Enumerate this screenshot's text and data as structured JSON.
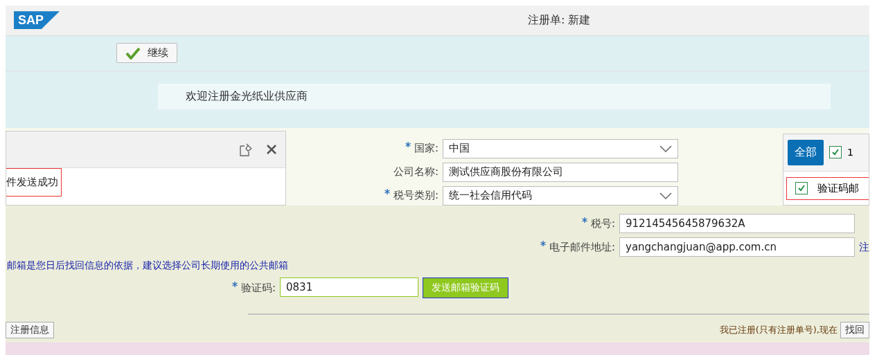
{
  "header": {
    "logo": "SAP",
    "title": "注册单: 新建"
  },
  "toolbar": {
    "continue_button": "继续"
  },
  "welcome": {
    "text": "欢迎注册金光纸业供应商"
  },
  "message_popup": {
    "message": "件发送成功"
  },
  "form_top": [
    {
      "label": "国家:",
      "required": true,
      "value": "中国",
      "kind": "select"
    },
    {
      "label": "公司名称:",
      "required": false,
      "value": "测试供应商股份有限公司",
      "kind": "input"
    },
    {
      "label": "税号类别:",
      "required": true,
      "value": "统一社会信用代码",
      "kind": "select"
    }
  ],
  "filter_panel": {
    "all_button": "全部",
    "checked": true,
    "count": "1",
    "items": [
      {
        "label": "验证码邮",
        "checked": true
      }
    ]
  },
  "form_bottom": [
    {
      "label": "税号:",
      "required": true,
      "value": "91214545645879632A"
    },
    {
      "label": "电子邮件地址:",
      "required": true,
      "value": "yangchangjuan@app.com.cn",
      "note": "注"
    }
  ],
  "email_hint": "邮箱是您日后找回信息的依据，建议选择公司长期使用的公共邮箱",
  "captcha": {
    "label": "验证码:",
    "required": true,
    "value": "0831",
    "send_button": "发送邮箱验证码"
  },
  "footer": {
    "left_button": "注册信息",
    "registered_text": "我已注册(只有注册单号),现在",
    "retrieve_button": "找回"
  }
}
